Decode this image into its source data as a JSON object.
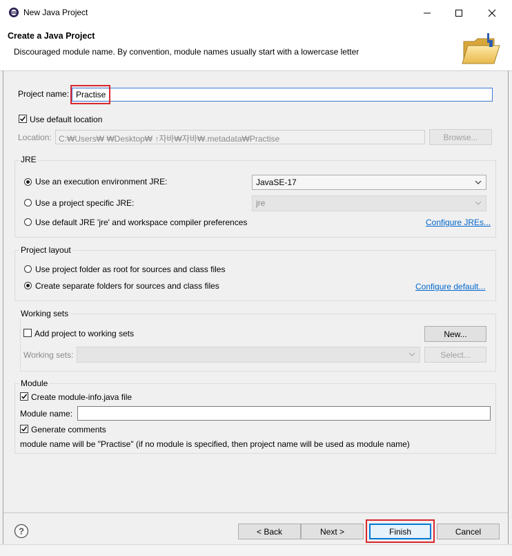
{
  "window": {
    "title": "New Java Project",
    "controls": {
      "minimize": "minimize",
      "maximize": "maximize",
      "close": "close"
    }
  },
  "header": {
    "title": "Create a Java Project",
    "message": "Discouraged module name. By convention, module names usually start with a lowercase letter",
    "icon": "folder-icon"
  },
  "project": {
    "name_label": "Project name:",
    "name_value": "Practise",
    "use_default_location_label": "Use default location",
    "use_default_location_checked": true,
    "location_label": "Location:",
    "location_value": "C:₩Users₩          ₩Desktop₩          ↑자바₩자바₩.metadata₩Practise",
    "browse_label": "Browse..."
  },
  "jre": {
    "group_label": "JRE",
    "options": [
      {
        "label": "Use an execution environment JRE:",
        "checked": true
      },
      {
        "label": "Use a project specific JRE:",
        "checked": false
      },
      {
        "label": "Use default JRE 'jre' and workspace compiler preferences",
        "checked": false
      }
    ],
    "env_selected": "JavaSE-17",
    "specific_selected": "jre",
    "configure_link": "Configure JREs..."
  },
  "layout": {
    "group_label": "Project layout",
    "options": [
      {
        "label": "Use project folder as root for sources and class files",
        "checked": false
      },
      {
        "label": "Create separate folders for sources and class files",
        "checked": true
      }
    ],
    "configure_link": "Configure default..."
  },
  "working_sets": {
    "group_label": "Working sets",
    "add_label": "Add project to working sets",
    "add_checked": false,
    "new_label": "New...",
    "sets_label": "Working sets:",
    "select_label": "Select..."
  },
  "module": {
    "group_label": "Module",
    "create_label": "Create module-info.java file",
    "create_checked": true,
    "name_label": "Module name:",
    "name_value": "",
    "comments_label": "Generate comments",
    "comments_checked": true,
    "info": "module name will be \"Practise\"  (if no module is specified, then project name will be used as module name)"
  },
  "footer": {
    "help_icon": "help-icon",
    "back_label": "< Back",
    "next_label": "Next >",
    "finish_label": "Finish",
    "cancel_label": "Cancel"
  },
  "colors": {
    "highlight_red": "#d9262c",
    "link_blue": "#0066cc",
    "focus_blue": "#0078d7"
  }
}
